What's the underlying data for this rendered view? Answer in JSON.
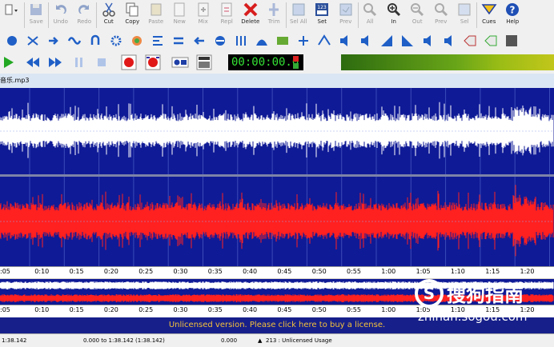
{
  "toolbar": {
    "items": [
      {
        "label": "",
        "icon": "file-dropdown-icon"
      },
      {
        "label": "Save",
        "icon": "save-icon",
        "enabled": false
      },
      {
        "label": "Undo",
        "icon": "undo-icon",
        "enabled": false
      },
      {
        "label": "Redo",
        "icon": "redo-icon",
        "enabled": false
      },
      {
        "label": "Cut",
        "icon": "cut-icon",
        "enabled": true
      },
      {
        "label": "Copy",
        "icon": "copy-icon",
        "enabled": true
      },
      {
        "label": "Paste",
        "icon": "paste-icon",
        "enabled": false
      },
      {
        "label": "New",
        "icon": "new-icon",
        "enabled": false
      },
      {
        "label": "Mix",
        "icon": "mix-icon",
        "enabled": false
      },
      {
        "label": "Repl",
        "icon": "replace-icon",
        "enabled": false
      },
      {
        "label": "Delete",
        "icon": "delete-icon",
        "enabled": true
      },
      {
        "label": "Trim",
        "icon": "trim-icon",
        "enabled": false
      },
      {
        "label": "Sel All",
        "icon": "select-all-icon",
        "enabled": false
      },
      {
        "label": "Set",
        "icon": "set-icon",
        "enabled": true
      },
      {
        "label": "Prev",
        "icon": "preview-icon",
        "enabled": false
      },
      {
        "label": "All",
        "icon": "zoom-all-icon",
        "enabled": false
      },
      {
        "label": "In",
        "icon": "zoom-in-icon",
        "enabled": true
      },
      {
        "label": "Out",
        "icon": "zoom-out-icon",
        "enabled": false
      },
      {
        "label": "Prev",
        "icon": "zoom-prev-icon",
        "enabled": false
      },
      {
        "label": "Sel",
        "icon": "zoom-sel-icon",
        "enabled": false
      },
      {
        "label": "Cues",
        "icon": "cues-icon",
        "enabled": true
      },
      {
        "label": "Help",
        "icon": "help-icon",
        "enabled": true
      }
    ],
    "set_icon_text": "123"
  },
  "transport": {
    "time": "00:00:00.0"
  },
  "file": {
    "tab_label": "音乐.mp3"
  },
  "ruler": {
    "ticks": [
      ":05",
      "0:10",
      "0:15",
      "0:20",
      "0:25",
      "0:30",
      "0:35",
      "0:40",
      "0:45",
      "0:50",
      "0:55",
      "1:00",
      "1:05",
      "1:10",
      "1:15",
      "1:20"
    ]
  },
  "license": {
    "text": "Unlicensed version. Please click here to buy a license."
  },
  "status": {
    "length": "1:38.142",
    "selection": "0.000 to 1:38.142 (1:38.142)",
    "cursor": "0.000",
    "usage": "213 : Unlicensed Usage"
  },
  "watermark": {
    "text": "搜狗指南",
    "url": "zhinan.sogou.com"
  },
  "colors": {
    "wave_bg": "#0f1a96",
    "left_channel": "#ffffff",
    "right_channel": "#ff2020",
    "license_text": "#f5c13b"
  }
}
